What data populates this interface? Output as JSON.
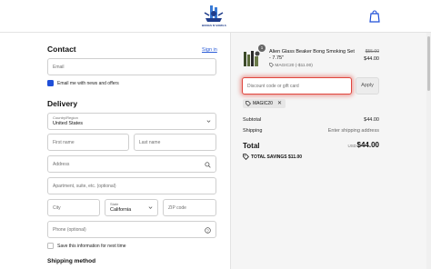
{
  "header": {
    "logo_text": "BONGS N' BOWLS"
  },
  "contact": {
    "title": "Contact",
    "sign_in": "Sign in",
    "email_placeholder": "Email",
    "newsletter_label": "Email me with news and offers",
    "newsletter_checked": true
  },
  "delivery": {
    "title": "Delivery",
    "country_label": "Country/Region",
    "country_value": "United States",
    "first_name_placeholder": "First name",
    "last_name_placeholder": "Last name",
    "address_placeholder": "Address",
    "apartment_placeholder": "Apartment, suite, etc. (optional)",
    "city_placeholder": "City",
    "state_label": "State",
    "state_value": "California",
    "zip_placeholder": "ZIP code",
    "phone_placeholder": "Phone (optional)",
    "save_info_label": "Save this information for next time",
    "save_info_checked": false
  },
  "shipping_method": {
    "title": "Shipping method"
  },
  "order": {
    "quantity": "1",
    "product_name": "Alien Glass Beaker Bong Smoking Set - 7.75\"",
    "product_discount": "MAGIC20 (-$11.00)",
    "price_original": "$55.00",
    "price_current": "$44.00",
    "discount_placeholder": "Discount code or gift card",
    "apply_label": "Apply",
    "applied_code": "MAGIC20",
    "remove_code_symbol": "✕",
    "subtotal_label": "Subtotal",
    "subtotal_value": "$44.00",
    "shipping_label": "Shipping",
    "shipping_value": "Enter shipping address",
    "total_label": "Total",
    "total_currency": "USD",
    "total_value": "$44.00",
    "savings_label": "TOTAL SAVINGS",
    "savings_value": "$11.00"
  },
  "colors": {
    "accent": "#1f4fd8",
    "link": "#2a5bd7",
    "highlight": "#e0463e",
    "summary_bg": "#f5f5f5"
  },
  "icons": [
    "logo-icon",
    "shopping-bag-icon",
    "chevron-down-icon",
    "search-icon",
    "help-circle-icon",
    "discount-tag-icon",
    "close-icon",
    "savings-tag-icon",
    "check-icon"
  ]
}
